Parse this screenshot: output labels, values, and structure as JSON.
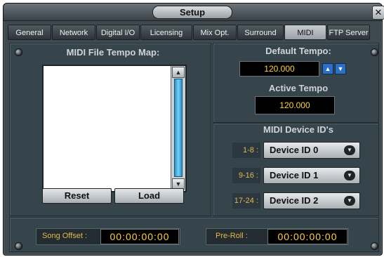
{
  "window": {
    "title": "Setup",
    "close_glyph": "✕"
  },
  "tabs": [
    {
      "label": "General"
    },
    {
      "label": "Network"
    },
    {
      "label": "Digital I/O"
    },
    {
      "label": "Licensing"
    },
    {
      "label": "Mix Opt."
    },
    {
      "label": "Surround"
    },
    {
      "label": "MIDI"
    },
    {
      "label": "FTP Server"
    }
  ],
  "active_tab": "MIDI",
  "tempo_map": {
    "title": "MIDI File Tempo Map:",
    "entries": [],
    "reset_label": "Reset",
    "load_label": "Load"
  },
  "default_tempo": {
    "title": "Default Tempo:",
    "value": "120.000"
  },
  "active_tempo": {
    "title": "Active Tempo",
    "value": "120.000"
  },
  "midi_devices": {
    "title": "MIDI Device ID's",
    "rows": [
      {
        "range": "1-8 :",
        "device": "Device ID 0"
      },
      {
        "range": "9-16 :",
        "device": "Device ID 1"
      },
      {
        "range": "17-24 :",
        "device": "Device ID 2"
      }
    ]
  },
  "song_offset": {
    "label": "Song Offset :",
    "value": "00:00:00:00"
  },
  "pre_roll": {
    "label": "Pre-Roll :",
    "value": "00:00:00:00"
  },
  "icons": {
    "spin_up": "▲",
    "spin_down": "▼",
    "dropdown": "▼"
  },
  "colors": {
    "panel": "#36444b",
    "lcd_text": "#ffd23a",
    "label_gold": "#e6b84a",
    "accent_blue": "#2c6fc4"
  }
}
